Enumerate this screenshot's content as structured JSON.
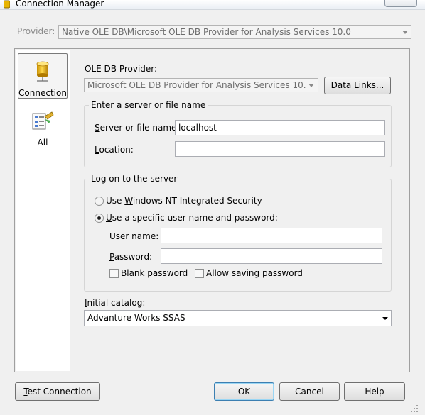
{
  "window": {
    "title": "Connection Manager"
  },
  "provider": {
    "label_pre": "Pro",
    "label_ul": "v",
    "label_post": "ider:",
    "value": "Native OLE DB\\Microsoft OLE DB Provider for Analysis Services 10.0"
  },
  "nav": {
    "items": [
      {
        "label": "Connection",
        "icon": "database-cylinder-icon"
      },
      {
        "label": "All",
        "icon": "properties-list-icon"
      }
    ]
  },
  "ole": {
    "label": "OLE DB Provider:",
    "value": "Microsoft OLE DB Provider for Analysis Services 10.0",
    "data_links_pre": "Data Lin",
    "data_links_ul": "k",
    "data_links_post": "s..."
  },
  "server_group": {
    "title": "Enter a server or file name",
    "server_label_ul": "S",
    "server_label_post": "erver or file name:",
    "server_value": "localhost",
    "location_label_ul": "L",
    "location_label_post": "ocation:",
    "location_value": ""
  },
  "logon_group": {
    "title": "Log on to the server",
    "radio_windows_pre": "Use ",
    "radio_windows_ul": "W",
    "radio_windows_post": "indows NT Integrated Security",
    "radio_specific_ul": "U",
    "radio_specific_post": "se a specific user name and password:",
    "username_pre": "User ",
    "username_ul": "n",
    "username_post": "ame:",
    "username_value": "",
    "password_ul": "P",
    "password_post": "assword:",
    "password_value": "",
    "blank_pw_ul": "B",
    "blank_pw_post": "lank password",
    "allow_save_pre": "Allow ",
    "allow_save_ul": "s",
    "allow_save_post": "aving password"
  },
  "catalog": {
    "label_ul": "I",
    "label_post": "nitial catalog:",
    "value": "Advanture Works SSAS"
  },
  "buttons": {
    "test_ul": "T",
    "test_post": "est Connection",
    "ok": "OK",
    "cancel": "Cancel",
    "help": "Help"
  }
}
